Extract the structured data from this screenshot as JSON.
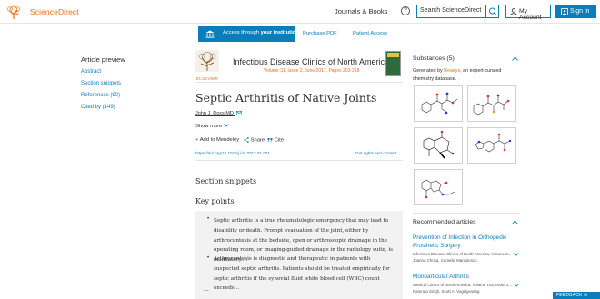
{
  "header": {
    "brand": "ScienceDirect",
    "journals_books": "Journals & Books",
    "help": "?",
    "search_placeholder": "Search ScienceDirect",
    "my_account": "My Account",
    "sign_in": "Sign in"
  },
  "toolbar": {
    "access_prefix": "Access through ",
    "access_bold": "your institution",
    "purchase_pdf": "Purchase PDF",
    "patient_access": "Patient Access"
  },
  "preview": {
    "title": "Article preview",
    "links": [
      "Abstract",
      "Section snippets",
      "References (90)",
      "Cited by (149)"
    ]
  },
  "article": {
    "publisher": "ELSEVIER",
    "journal": "Infectious Disease Clinics of North America",
    "journal_info": "Volume 31, Issue 2, June 2017, Pages 203-218",
    "title": "Septic Arthritis of Native Joints",
    "author": "John J. Ross MD",
    "show_more": "Show more",
    "actions": [
      "Add to Mendeley",
      "Share",
      "Cite"
    ],
    "doi": "https://doi.org/10.1016/j.idc.2017.01.001",
    "rights": "Get rights and content",
    "section_snippets": "Section snippets",
    "key_points": "Key points",
    "points": [
      "Septic arthritis is a true rheumatologic emergency that may lead to disability or death. Prompt evacuation of the joint, either by arthrocentesis at the bedside, open or arthroscopic drainage in the operating room, or imaging-guided drainage in the radiology suite, is mandatory.…",
      "Arthrocentesis is diagnostic and therapeutic in patients with suspected septic arthritis. Patients should be treated empirically for septic arthritis if the synovial fluid white blood cell (WBC) count exceeds…"
    ],
    "ellipsis": "..."
  },
  "sidebar": {
    "substances_title": "Substances (5)",
    "generated_prefix": "Generated by ",
    "reaxys": "Reaxys",
    "generated_suffix": ", an expert-curated chemistry database.",
    "recommended_title": "Recommended articles",
    "recommended": [
      {
        "title": "Prevention of Infection in Orthopedic Prosthetic Surgery",
        "journal": "Infectious Disease Clinics of North America, Volume 3...",
        "authors": "Joanna Chrisa, Camelia Marculescu"
      },
      {
        "title": "Monoarticular Arthritis",
        "journal": "Medical Clinics of North America, Volume 105, Issue 2...",
        "authors": "Namrata Singh, Scott A. Vogelgesang"
      }
    ]
  },
  "feedback": "FEEDBACK",
  "colors": {
    "accent": "#0c7dbb",
    "brand": "#e9711c"
  }
}
